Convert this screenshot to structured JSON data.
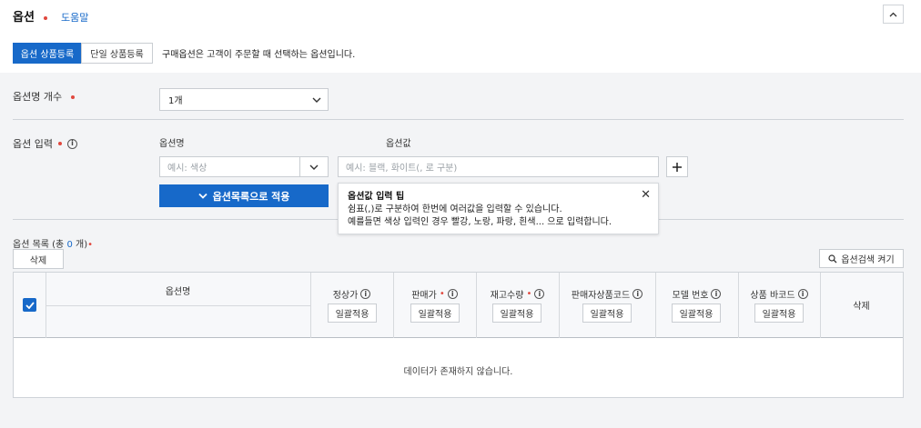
{
  "header": {
    "title": "옵션",
    "help_link": "도움말"
  },
  "tabs": [
    {
      "label": "옵션 상품등록",
      "active": true
    },
    {
      "label": "단일 상품등록",
      "active": false
    }
  ],
  "tab_description": "구매옵션은 고객이 주문할 때 선택하는 옵션입니다.",
  "option_count": {
    "label": "옵션명 개수",
    "selected": "1개"
  },
  "option_input": {
    "label": "옵션 입력",
    "name_header": "옵션명",
    "value_header": "옵션값",
    "name_placeholder": "예시: 색상",
    "value_placeholder": "예시: 블랙, 화이트(, 로 구분)",
    "apply_button": "옵션목록으로 적용"
  },
  "tooltip": {
    "title": "옵션값 입력 팁",
    "line1": "쉼표(,)로 구분하여 한번에 여러값을 입력할 수 있습니다.",
    "line2": "예를들면 색상 입력인 경우 빨강, 노랑, 파랑, 흰색... 으로 입력합니다."
  },
  "option_list": {
    "label_prefix": "옵션 목록 (총 ",
    "count": "0",
    "label_suffix": " 개)",
    "delete_button": "삭제",
    "search_toggle": "옵션검색 켜기",
    "columns": [
      {
        "label": "옵션명"
      },
      {
        "label": "정상가",
        "bulk": "일괄적용"
      },
      {
        "label": "판매가",
        "bulk": "일괄적용"
      },
      {
        "label": "재고수량",
        "bulk": "일괄적용"
      },
      {
        "label": "판매자상품코드",
        "bulk": "일괄적용"
      },
      {
        "label": "모델 번호",
        "bulk": "일괄적용"
      },
      {
        "label": "상품 바코드",
        "bulk": "일괄적용"
      },
      {
        "label": "삭제"
      }
    ],
    "empty_message": "데이터가 존재하지 않습니다."
  },
  "colors": {
    "accent": "#1769c9",
    "required": "#e0483e"
  }
}
